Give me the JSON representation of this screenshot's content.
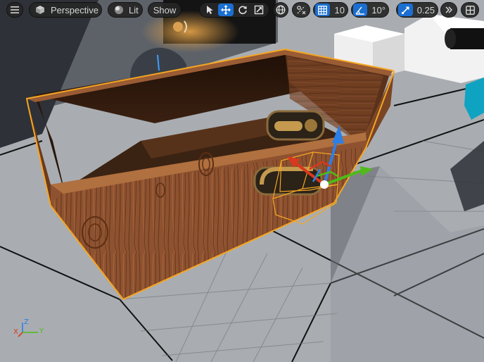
{
  "toolbar": {
    "menu_icon": "hamburger-menu-icon",
    "view_mode": "Perspective",
    "lighting_mode": "Lit",
    "show_label": "Show",
    "grid_snap_value": "10",
    "rotation_snap_value": "10°",
    "scale_snap_value": "0.25",
    "active_transform_tool": "translate",
    "colors": {
      "accent": "#1b6fd1",
      "toolbar_bg": "#262626",
      "text": "#d6d6d6"
    }
  },
  "axis_indicator": {
    "x_label": "X",
    "y_label": "Y",
    "z_label": "Z"
  },
  "colors": {
    "selection_outline": "#f5a623",
    "gizmo_x": "#d9381e",
    "gizmo_y": "#4fba19",
    "gizmo_z": "#2c7fe6",
    "wood": "#8a4e2a",
    "floor_tile": "#a7abb0",
    "grid_line": "#111111"
  }
}
